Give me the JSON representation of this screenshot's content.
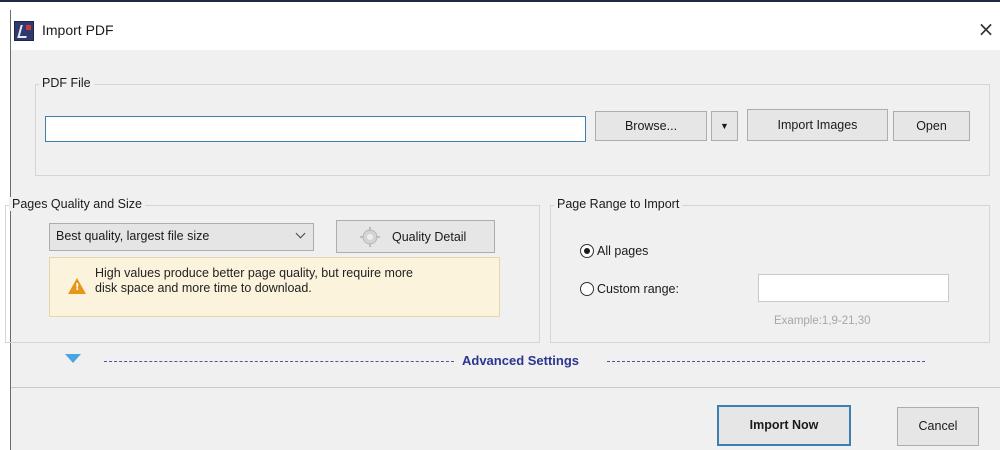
{
  "window": {
    "title": "Import PDF",
    "close_glyph": "×"
  },
  "pdf_file": {
    "group_label": "PDF File",
    "path_value": "",
    "browse_label": "Browse...",
    "browse_dropdown_glyph": "▼",
    "import_images_label": "Import Images",
    "open_label": "Open"
  },
  "quality": {
    "group_label": "Pages Quality and Size",
    "selected": "Best quality, largest file size",
    "detail_button_label": "Quality Detail",
    "warning_text": "High values produce better page quality, but require more disk space and more time to download."
  },
  "page_range": {
    "group_label": "Page Range to Import",
    "all_pages_label": "All pages",
    "custom_range_label": "Custom range:",
    "custom_range_value": "",
    "example_hint": "Example:1,9-21,30",
    "selected_option": "all"
  },
  "advanced": {
    "label": "Advanced Settings"
  },
  "footer": {
    "import_now_label": "Import Now",
    "cancel_label": "Cancel"
  },
  "colors": {
    "accent": "#3c7fb1",
    "advanced_text": "#2a3590",
    "warning_bg": "#fbf3dc",
    "warning_icon": "#e8951a",
    "dialog_bg": "#f0f0f0"
  }
}
